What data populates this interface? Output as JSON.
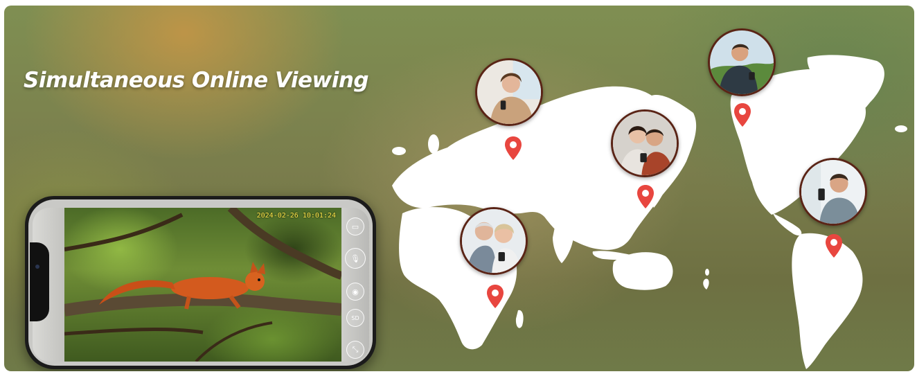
{
  "banner": {
    "title": "Simultaneous Online Viewing"
  },
  "phone": {
    "timestamp": "2024-02-26 10:01:24",
    "controls": [
      "video-icon",
      "mic-icon",
      "camera-icon",
      "sd-icon",
      "fullscreen-exit-icon"
    ],
    "sd_label": "SD"
  },
  "viewers": [
    {
      "name": "viewer-woman-phone",
      "icon": "location-pin-icon"
    },
    {
      "name": "viewer-older-couple",
      "icon": "location-pin-icon"
    },
    {
      "name": "viewer-couple-sofa",
      "icon": "location-pin-icon"
    },
    {
      "name": "viewer-hiker",
      "icon": "location-pin-icon"
    },
    {
      "name": "viewer-man-phone",
      "icon": "location-pin-icon"
    }
  ],
  "colors": {
    "pin": "#e8463f",
    "avatar_border": "#5a2416",
    "timestamp": "#ffe94a"
  }
}
